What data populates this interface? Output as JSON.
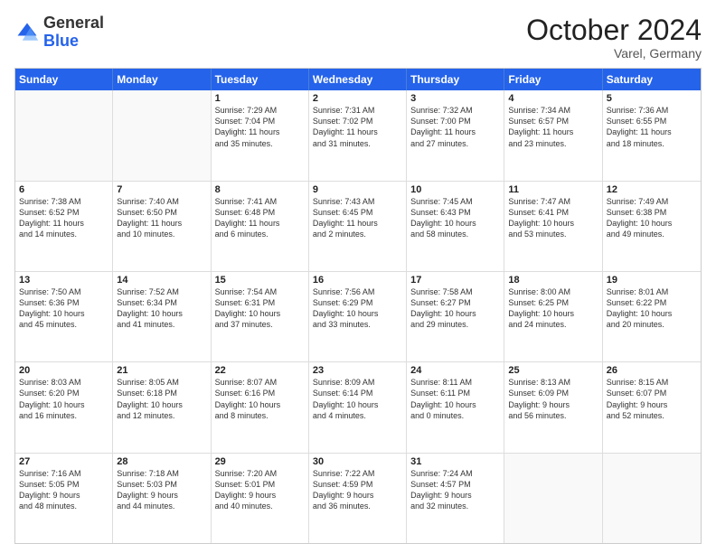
{
  "header": {
    "logo_general": "General",
    "logo_blue": "Blue",
    "month_title": "October 2024",
    "location": "Varel, Germany"
  },
  "days_of_week": [
    "Sunday",
    "Monday",
    "Tuesday",
    "Wednesday",
    "Thursday",
    "Friday",
    "Saturday"
  ],
  "weeks": [
    [
      {
        "day": "",
        "empty": true
      },
      {
        "day": "",
        "empty": true
      },
      {
        "day": "1",
        "line1": "Sunrise: 7:29 AM",
        "line2": "Sunset: 7:04 PM",
        "line3": "Daylight: 11 hours",
        "line4": "and 35 minutes."
      },
      {
        "day": "2",
        "line1": "Sunrise: 7:31 AM",
        "line2": "Sunset: 7:02 PM",
        "line3": "Daylight: 11 hours",
        "line4": "and 31 minutes."
      },
      {
        "day": "3",
        "line1": "Sunrise: 7:32 AM",
        "line2": "Sunset: 7:00 PM",
        "line3": "Daylight: 11 hours",
        "line4": "and 27 minutes."
      },
      {
        "day": "4",
        "line1": "Sunrise: 7:34 AM",
        "line2": "Sunset: 6:57 PM",
        "line3": "Daylight: 11 hours",
        "line4": "and 23 minutes."
      },
      {
        "day": "5",
        "line1": "Sunrise: 7:36 AM",
        "line2": "Sunset: 6:55 PM",
        "line3": "Daylight: 11 hours",
        "line4": "and 18 minutes."
      }
    ],
    [
      {
        "day": "6",
        "line1": "Sunrise: 7:38 AM",
        "line2": "Sunset: 6:52 PM",
        "line3": "Daylight: 11 hours",
        "line4": "and 14 minutes."
      },
      {
        "day": "7",
        "line1": "Sunrise: 7:40 AM",
        "line2": "Sunset: 6:50 PM",
        "line3": "Daylight: 11 hours",
        "line4": "and 10 minutes."
      },
      {
        "day": "8",
        "line1": "Sunrise: 7:41 AM",
        "line2": "Sunset: 6:48 PM",
        "line3": "Daylight: 11 hours",
        "line4": "and 6 minutes."
      },
      {
        "day": "9",
        "line1": "Sunrise: 7:43 AM",
        "line2": "Sunset: 6:45 PM",
        "line3": "Daylight: 11 hours",
        "line4": "and 2 minutes."
      },
      {
        "day": "10",
        "line1": "Sunrise: 7:45 AM",
        "line2": "Sunset: 6:43 PM",
        "line3": "Daylight: 10 hours",
        "line4": "and 58 minutes."
      },
      {
        "day": "11",
        "line1": "Sunrise: 7:47 AM",
        "line2": "Sunset: 6:41 PM",
        "line3": "Daylight: 10 hours",
        "line4": "and 53 minutes."
      },
      {
        "day": "12",
        "line1": "Sunrise: 7:49 AM",
        "line2": "Sunset: 6:38 PM",
        "line3": "Daylight: 10 hours",
        "line4": "and 49 minutes."
      }
    ],
    [
      {
        "day": "13",
        "line1": "Sunrise: 7:50 AM",
        "line2": "Sunset: 6:36 PM",
        "line3": "Daylight: 10 hours",
        "line4": "and 45 minutes."
      },
      {
        "day": "14",
        "line1": "Sunrise: 7:52 AM",
        "line2": "Sunset: 6:34 PM",
        "line3": "Daylight: 10 hours",
        "line4": "and 41 minutes."
      },
      {
        "day": "15",
        "line1": "Sunrise: 7:54 AM",
        "line2": "Sunset: 6:31 PM",
        "line3": "Daylight: 10 hours",
        "line4": "and 37 minutes."
      },
      {
        "day": "16",
        "line1": "Sunrise: 7:56 AM",
        "line2": "Sunset: 6:29 PM",
        "line3": "Daylight: 10 hours",
        "line4": "and 33 minutes."
      },
      {
        "day": "17",
        "line1": "Sunrise: 7:58 AM",
        "line2": "Sunset: 6:27 PM",
        "line3": "Daylight: 10 hours",
        "line4": "and 29 minutes."
      },
      {
        "day": "18",
        "line1": "Sunrise: 8:00 AM",
        "line2": "Sunset: 6:25 PM",
        "line3": "Daylight: 10 hours",
        "line4": "and 24 minutes."
      },
      {
        "day": "19",
        "line1": "Sunrise: 8:01 AM",
        "line2": "Sunset: 6:22 PM",
        "line3": "Daylight: 10 hours",
        "line4": "and 20 minutes."
      }
    ],
    [
      {
        "day": "20",
        "line1": "Sunrise: 8:03 AM",
        "line2": "Sunset: 6:20 PM",
        "line3": "Daylight: 10 hours",
        "line4": "and 16 minutes."
      },
      {
        "day": "21",
        "line1": "Sunrise: 8:05 AM",
        "line2": "Sunset: 6:18 PM",
        "line3": "Daylight: 10 hours",
        "line4": "and 12 minutes."
      },
      {
        "day": "22",
        "line1": "Sunrise: 8:07 AM",
        "line2": "Sunset: 6:16 PM",
        "line3": "Daylight: 10 hours",
        "line4": "and 8 minutes."
      },
      {
        "day": "23",
        "line1": "Sunrise: 8:09 AM",
        "line2": "Sunset: 6:14 PM",
        "line3": "Daylight: 10 hours",
        "line4": "and 4 minutes."
      },
      {
        "day": "24",
        "line1": "Sunrise: 8:11 AM",
        "line2": "Sunset: 6:11 PM",
        "line3": "Daylight: 10 hours",
        "line4": "and 0 minutes."
      },
      {
        "day": "25",
        "line1": "Sunrise: 8:13 AM",
        "line2": "Sunset: 6:09 PM",
        "line3": "Daylight: 9 hours",
        "line4": "and 56 minutes."
      },
      {
        "day": "26",
        "line1": "Sunrise: 8:15 AM",
        "line2": "Sunset: 6:07 PM",
        "line3": "Daylight: 9 hours",
        "line4": "and 52 minutes."
      }
    ],
    [
      {
        "day": "27",
        "line1": "Sunrise: 7:16 AM",
        "line2": "Sunset: 5:05 PM",
        "line3": "Daylight: 9 hours",
        "line4": "and 48 minutes."
      },
      {
        "day": "28",
        "line1": "Sunrise: 7:18 AM",
        "line2": "Sunset: 5:03 PM",
        "line3": "Daylight: 9 hours",
        "line4": "and 44 minutes."
      },
      {
        "day": "29",
        "line1": "Sunrise: 7:20 AM",
        "line2": "Sunset: 5:01 PM",
        "line3": "Daylight: 9 hours",
        "line4": "and 40 minutes."
      },
      {
        "day": "30",
        "line1": "Sunrise: 7:22 AM",
        "line2": "Sunset: 4:59 PM",
        "line3": "Daylight: 9 hours",
        "line4": "and 36 minutes."
      },
      {
        "day": "31",
        "line1": "Sunrise: 7:24 AM",
        "line2": "Sunset: 4:57 PM",
        "line3": "Daylight: 9 hours",
        "line4": "and 32 minutes."
      },
      {
        "day": "",
        "empty": true
      },
      {
        "day": "",
        "empty": true
      }
    ]
  ]
}
